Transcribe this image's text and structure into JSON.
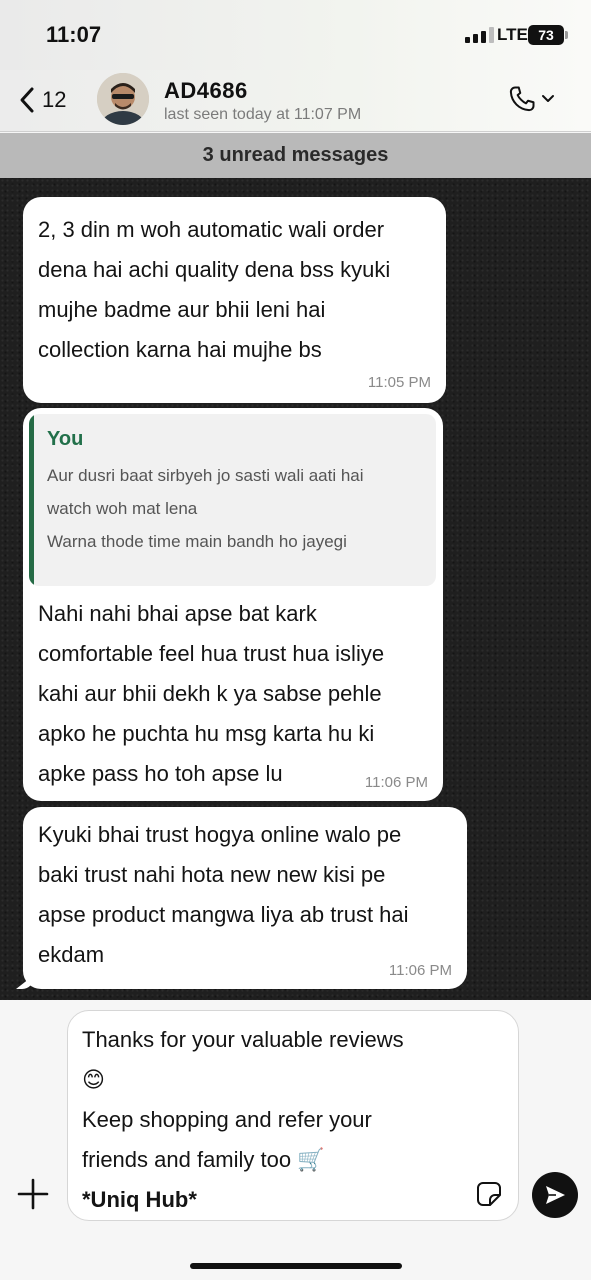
{
  "status_bar": {
    "time": "11:07",
    "network": "LTE",
    "battery": "73",
    "signal_bars": 4,
    "signal_bars_active": 3
  },
  "header": {
    "back_count": "12",
    "contact_name": "AD4686",
    "last_seen": "last seen today at 11:07 PM"
  },
  "unread_banner": "3 unread messages",
  "messages": [
    {
      "lines": [
        "2, 3 din m woh automatic wali order",
        "dena hai achi quality dena bss kyuki",
        "mujhe badme aur bhii leni hai",
        "collection karna hai mujhe bs"
      ],
      "time": "11:05 PM"
    },
    {
      "quote": {
        "author": "You",
        "lines": [
          "Aur dusri baat sirbyeh jo sasti wali aati hai",
          "watch woh mat lena",
          "Warna thode time main bandh ho jayegi"
        ]
      },
      "lines": [
        "Nahi nahi bhai apse bat kark",
        "comfortable feel hua trust hua isliye",
        "kahi aur bhii dekh k ya sabse pehle",
        "apko he puchta hu msg karta hu ki",
        "apke pass ho toh apse lu"
      ],
      "time": "11:06 PM"
    },
    {
      "lines": [
        "Kyuki bhai trust hogya online walo pe",
        "baki trust nahi hota new new kisi pe",
        "apse product mangwa liya ab trust hai",
        "ekdam"
      ],
      "time": "11:06 PM"
    }
  ],
  "composer": {
    "draft_lines": [
      "Thanks for your valuable reviews",
      "😊",
      "Keep shopping and refer your",
      "friends and family too 🛒",
      "*Uniq Hub*"
    ]
  },
  "icons": {
    "back": "chevron-left-icon",
    "call": "phone-icon",
    "call_menu": "chevron-down-icon",
    "attach": "plus-icon",
    "sticker": "sticker-icon",
    "send": "send-icon"
  },
  "colors": {
    "quote_accent": "#256b46",
    "quote_author": "#22704a",
    "unread_bar": "#b9b9b9",
    "chat_background": "#1f1f1f"
  }
}
